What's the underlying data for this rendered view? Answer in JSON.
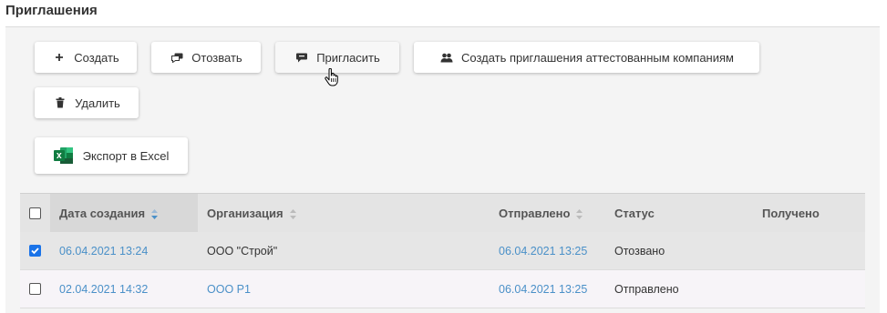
{
  "page": {
    "title": "Приглашения"
  },
  "toolbar": {
    "create_label": "Создать",
    "revoke_label": "Отозвать",
    "invite_label": "Пригласить",
    "invite_attested_label": "Создать приглашения аттестованным компаниям",
    "delete_label": "Удалить",
    "export_label": "Экспорт в Excel"
  },
  "icons": {
    "create": "plus-icon",
    "revoke": "speech-bubbles-icon",
    "invite": "speech-bubble-icon",
    "invite_attested": "users-icon",
    "delete": "trash-icon",
    "export": "excel-icon",
    "cursor": "hand-pointer-icon"
  },
  "colors": {
    "link": "#4a90c8",
    "checkbox": "#1a73e8",
    "excel": "#1d6f42"
  },
  "table": {
    "columns": [
      "Дата создания",
      "Организация",
      "Отправлено",
      "Статус",
      "Получено"
    ],
    "sorted_column": "Дата создания",
    "rows": [
      {
        "checked": true,
        "created": "06.04.2021 13:24",
        "org": "ООО \"Строй\"",
        "sent": "06.04.2021 13:25",
        "status": "Отозвано",
        "received": ""
      },
      {
        "checked": false,
        "created": "02.04.2021 14:32",
        "org": "ООО Р1",
        "sent": "06.04.2021 13:25",
        "status": "Отправлено",
        "received": ""
      }
    ]
  }
}
